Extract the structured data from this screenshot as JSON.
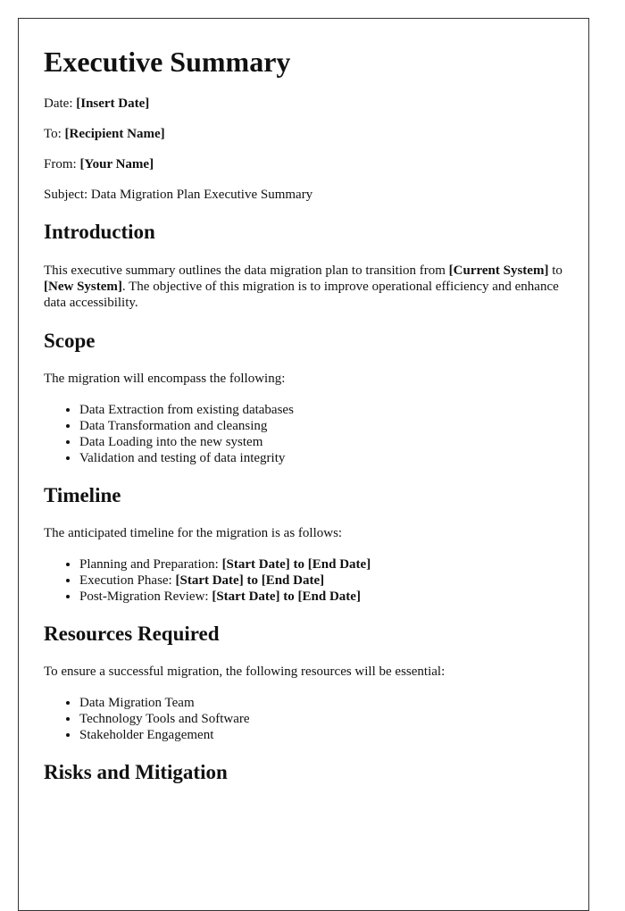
{
  "title": "Executive Summary",
  "meta": {
    "date_label": "Date: ",
    "date_value": "[Insert Date]",
    "to_label": "To: ",
    "to_value": "[Recipient Name]",
    "from_label": "From: ",
    "from_value": "[Your Name]",
    "subject": "Subject: Data Migration Plan Executive Summary"
  },
  "introduction": {
    "heading": "Introduction",
    "text_1": "This executive summary outlines the data migration plan to transition from ",
    "current_system": "[Current System]",
    "text_2": " to ",
    "new_system": "[New System]",
    "text_3": ". The objective of this migration is to improve operational efficiency and enhance data accessibility."
  },
  "scope": {
    "heading": "Scope",
    "intro": "The migration will encompass the following:",
    "items": [
      "Data Extraction from existing databases",
      "Data Transformation and cleansing",
      "Data Loading into the new system",
      "Validation and testing of data integrity"
    ]
  },
  "timeline": {
    "heading": "Timeline",
    "intro": "The anticipated timeline for the migration is as follows:",
    "items": [
      {
        "label": "Planning and Preparation: ",
        "range": "[Start Date] to [End Date]"
      },
      {
        "label": "Execution Phase: ",
        "range": "[Start Date] to [End Date]"
      },
      {
        "label": "Post-Migration Review: ",
        "range": "[Start Date] to [End Date]"
      }
    ]
  },
  "resources": {
    "heading": "Resources Required",
    "intro": "To ensure a successful migration, the following resources will be essential:",
    "items": [
      "Data Migration Team",
      "Technology Tools and Software",
      "Stakeholder Engagement"
    ]
  },
  "risks": {
    "heading": "Risks and Mitigation"
  }
}
